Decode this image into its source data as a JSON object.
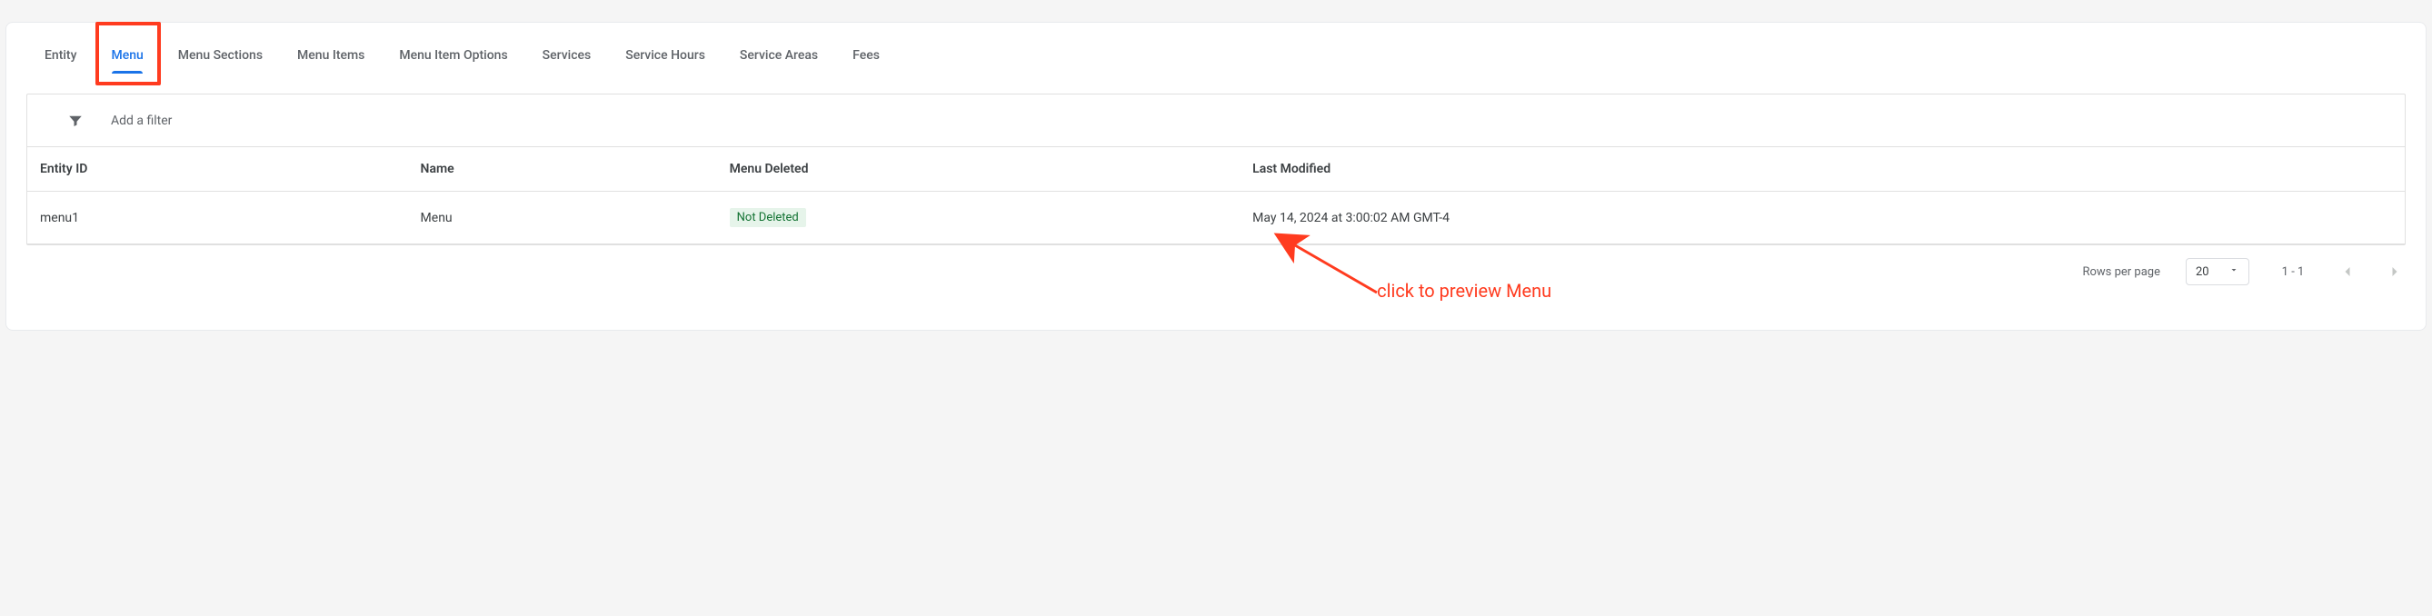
{
  "tabs": [
    {
      "label": "Entity",
      "active": false
    },
    {
      "label": "Menu",
      "active": true
    },
    {
      "label": "Menu Sections",
      "active": false
    },
    {
      "label": "Menu Items",
      "active": false
    },
    {
      "label": "Menu Item Options",
      "active": false
    },
    {
      "label": "Services",
      "active": false
    },
    {
      "label": "Service Hours",
      "active": false
    },
    {
      "label": "Service Areas",
      "active": false
    },
    {
      "label": "Fees",
      "active": false
    }
  ],
  "filter": {
    "placeholder": "Add a filter"
  },
  "table": {
    "columns": [
      "Entity ID",
      "Name",
      "Menu Deleted",
      "Last Modified"
    ],
    "rows": [
      {
        "entity_id": "menu1",
        "name": "Menu",
        "deleted_badge": "Not Deleted",
        "last_modified": "May 14, 2024 at 3:00:02 AM GMT-4"
      }
    ]
  },
  "pagination": {
    "rows_label": "Rows per page",
    "page_size": "20",
    "range": "1 - 1"
  },
  "annotation": {
    "text": "click to preview Menu"
  }
}
